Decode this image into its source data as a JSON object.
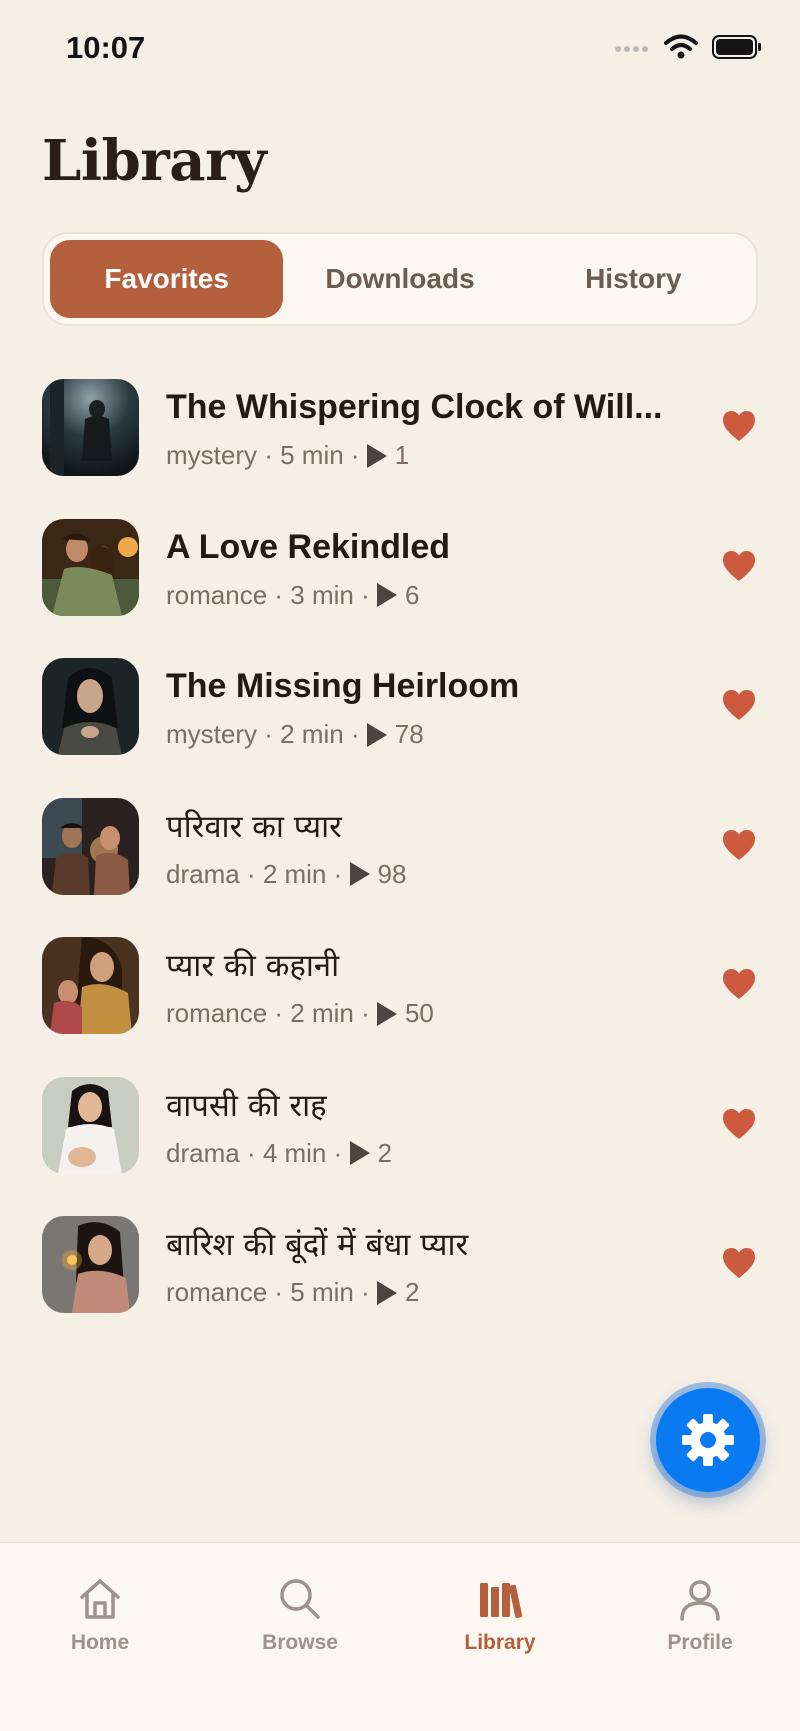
{
  "status": {
    "time": "10:07"
  },
  "page": {
    "title": "Library"
  },
  "tabs": [
    {
      "label": "Favorites",
      "active": true
    },
    {
      "label": "Downloads",
      "active": false
    },
    {
      "label": "History",
      "active": false
    }
  ],
  "stories": [
    {
      "title": "The Whispering Clock of Will...",
      "genre": "mystery",
      "duration": "5 min",
      "plays": "1",
      "favorited": true
    },
    {
      "title": "A Love Rekindled",
      "genre": "romance",
      "duration": "3 min",
      "plays": "6",
      "favorited": true
    },
    {
      "title": "The Missing Heirloom",
      "genre": "mystery",
      "duration": "2 min",
      "plays": "78",
      "favorited": true
    },
    {
      "title": "परिवार का प्यार",
      "genre": "drama",
      "duration": "2 min",
      "plays": "98",
      "favorited": true
    },
    {
      "title": "प्यार की कहानी",
      "genre": "romance",
      "duration": "2 min",
      "plays": "50",
      "favorited": true
    },
    {
      "title": "वापसी की राह",
      "genre": "drama",
      "duration": "4 min",
      "plays": "2",
      "favorited": true
    },
    {
      "title": "बारिश की बूंदों में बंधा प्यार",
      "genre": "romance",
      "duration": "5 min",
      "plays": "2",
      "favorited": true
    }
  ],
  "nav": [
    {
      "label": "Home",
      "icon": "home-icon",
      "active": false
    },
    {
      "label": "Browse",
      "icon": "search-icon",
      "active": false
    },
    {
      "label": "Library",
      "icon": "library-icon",
      "active": true
    },
    {
      "label": "Profile",
      "icon": "profile-icon",
      "active": false
    }
  ],
  "colors": {
    "background": "#f5efe6",
    "accent": "#b5603c",
    "heart": "#cc5a3f",
    "fab": "#0a7af2"
  }
}
